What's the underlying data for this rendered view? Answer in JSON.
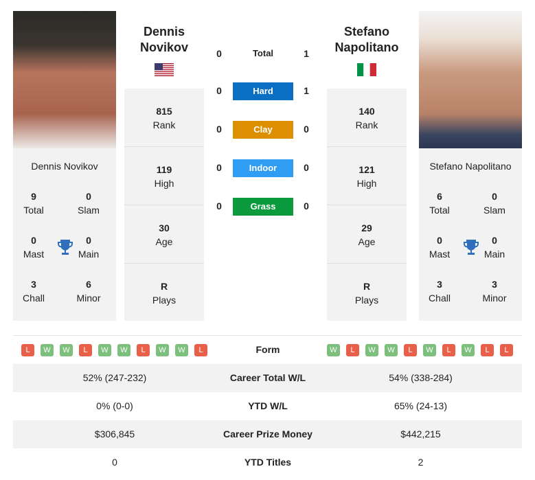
{
  "players": [
    {
      "name": "Dennis Novikov",
      "name_lines": [
        "Dennis",
        "Novikov"
      ],
      "flag": "usa-flag",
      "titles": {
        "total": "9",
        "slam": "0",
        "mast": "0",
        "main": "0",
        "chall": "3",
        "minor": "6"
      },
      "rank": "815",
      "high": "119",
      "age": "30",
      "plays": "R",
      "form": [
        "L",
        "W",
        "W",
        "L",
        "W",
        "W",
        "L",
        "W",
        "W",
        "L"
      ]
    },
    {
      "name": "Stefano Napolitano",
      "name_lines": [
        "Stefano",
        "Napolitano"
      ],
      "flag": "italy-flag",
      "titles": {
        "total": "6",
        "slam": "0",
        "mast": "0",
        "main": "0",
        "chall": "3",
        "minor": "3"
      },
      "rank": "140",
      "high": "121",
      "age": "29",
      "plays": "R",
      "form": [
        "W",
        "L",
        "W",
        "W",
        "L",
        "W",
        "L",
        "W",
        "L",
        "L"
      ]
    }
  ],
  "labels": {
    "total": "Total",
    "slam": "Slam",
    "mast": "Mast",
    "main": "Main",
    "chall": "Chall",
    "minor": "Minor",
    "rank": "Rank",
    "high": "High",
    "age": "Age",
    "plays": "Plays"
  },
  "h2h": [
    {
      "label": "Total",
      "left": "0",
      "right": "1",
      "color": ""
    },
    {
      "label": "Hard",
      "left": "0",
      "right": "1",
      "color": "#0a6fc2"
    },
    {
      "label": "Clay",
      "left": "0",
      "right": "0",
      "color": "#dc8f00"
    },
    {
      "label": "Indoor",
      "left": "0",
      "right": "0",
      "color": "#2f9df4"
    },
    {
      "label": "Grass",
      "left": "0",
      "right": "0",
      "color": "#0b9a3e"
    }
  ],
  "form_label": "Form",
  "comparison": [
    {
      "label": "Career Total W/L",
      "left": "52% (247-232)",
      "right": "54% (338-284)"
    },
    {
      "label": "YTD W/L",
      "left": "0% (0-0)",
      "right": "65% (24-13)"
    },
    {
      "label": "Career Prize Money",
      "left": "$306,845",
      "right": "$442,215"
    },
    {
      "label": "YTD Titles",
      "left": "0",
      "right": "2"
    }
  ]
}
